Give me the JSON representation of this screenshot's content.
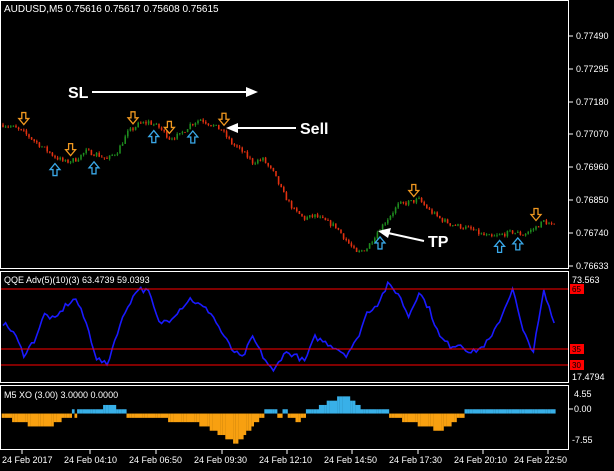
{
  "colors": {
    "background": "#000000",
    "frame": "#ffffff",
    "bull": "#1e8c1e",
    "bear": "#e03010",
    "buy_arrow": "#3aa8e8",
    "sell_arrow": "#f09820",
    "qqe_line": "#1a1aff",
    "level_line": "#ff0000",
    "xo_positive": "#38b0e8",
    "xo_negative": "#f8a010",
    "annotation": "#ffffff"
  },
  "main_chart": {
    "title": "AUDUSD,M5  0.75616 0.75617 0.75608 0.75615",
    "y_labels": [
      "0.77490",
      "0.77295",
      "0.77180",
      "0.77070",
      "0.76960",
      "0.76850",
      "0.76740",
      "0.76633"
    ],
    "annotations": [
      "SL",
      "Sell",
      "TP"
    ]
  },
  "qqe_panel": {
    "title": "QQE Adv(5)(10)(3) 63.4739 59.0393",
    "top_label": "73.563",
    "bottom_label": "17.4794",
    "levels": [
      "65",
      "35",
      "30"
    ]
  },
  "xo_panel": {
    "title": "M5 XO (3.00) 3.0000 0.0000",
    "y_labels": [
      "4.55",
      "0.00",
      "-7.55"
    ]
  },
  "time_axis": [
    "24 Feb 2017",
    "24 Feb 04:10",
    "24 Feb 06:50",
    "24 Feb 09:30",
    "24 Feb 12:10",
    "24 Feb 14:50",
    "24 Feb 17:30",
    "24 Feb 20:10",
    "24 Feb 22:50"
  ],
  "chart_data": {
    "type": "line",
    "close_key": [
      [
        0,
        0.7716
      ],
      [
        4,
        0.7715
      ],
      [
        8,
        0.7713
      ],
      [
        12,
        0.771
      ],
      [
        16,
        0.7707
      ],
      [
        20,
        0.7704
      ],
      [
        24,
        0.7702
      ],
      [
        28,
        0.7703
      ],
      [
        32,
        0.7706
      ],
      [
        36,
        0.7705
      ],
      [
        40,
        0.7703
      ],
      [
        44,
        0.7706
      ],
      [
        48,
        0.7713
      ],
      [
        52,
        0.7716
      ],
      [
        56,
        0.7717
      ],
      [
        60,
        0.7715
      ],
      [
        64,
        0.7711
      ],
      [
        68,
        0.7712
      ],
      [
        72,
        0.7716
      ],
      [
        76,
        0.7718
      ],
      [
        80,
        0.7716
      ],
      [
        84,
        0.7714
      ],
      [
        88,
        0.7709
      ],
      [
        92,
        0.7706
      ],
      [
        96,
        0.7702
      ],
      [
        100,
        0.7703
      ],
      [
        104,
        0.7698
      ],
      [
        108,
        0.769
      ],
      [
        112,
        0.7684
      ],
      [
        116,
        0.7681
      ],
      [
        120,
        0.7682
      ],
      [
        124,
        0.768
      ],
      [
        128,
        0.7678
      ],
      [
        132,
        0.7673
      ],
      [
        136,
        0.7668
      ],
      [
        140,
        0.767
      ],
      [
        144,
        0.7676
      ],
      [
        148,
        0.7681
      ],
      [
        152,
        0.7686
      ],
      [
        156,
        0.7687
      ],
      [
        160,
        0.7688
      ],
      [
        164,
        0.7684
      ],
      [
        168,
        0.7681
      ],
      [
        172,
        0.7679
      ],
      [
        176,
        0.7678
      ],
      [
        180,
        0.7677
      ],
      [
        184,
        0.7675
      ],
      [
        188,
        0.7674
      ],
      [
        192,
        0.7675
      ],
      [
        196,
        0.7676
      ],
      [
        200,
        0.7675
      ],
      [
        204,
        0.7677
      ],
      [
        208,
        0.768
      ],
      [
        212,
        0.7678
      ]
    ],
    "qqe_key": [
      [
        0,
        50
      ],
      [
        4,
        45
      ],
      [
        8,
        32
      ],
      [
        12,
        40
      ],
      [
        16,
        55
      ],
      [
        20,
        52
      ],
      [
        24,
        60
      ],
      [
        28,
        64
      ],
      [
        32,
        50
      ],
      [
        36,
        30
      ],
      [
        40,
        26
      ],
      [
        44,
        45
      ],
      [
        48,
        60
      ],
      [
        52,
        70
      ],
      [
        56,
        68
      ],
      [
        60,
        50
      ],
      [
        64,
        52
      ],
      [
        68,
        58
      ],
      [
        72,
        64
      ],
      [
        76,
        60
      ],
      [
        80,
        56
      ],
      [
        84,
        45
      ],
      [
        88,
        35
      ],
      [
        92,
        30
      ],
      [
        96,
        42
      ],
      [
        100,
        31
      ],
      [
        104,
        22
      ],
      [
        108,
        33
      ],
      [
        112,
        32
      ],
      [
        116,
        28
      ],
      [
        120,
        42
      ],
      [
        124,
        39
      ],
      [
        128,
        36
      ],
      [
        132,
        32
      ],
      [
        136,
        40
      ],
      [
        140,
        56
      ],
      [
        144,
        61
      ],
      [
        148,
        72
      ],
      [
        152,
        67
      ],
      [
        156,
        54
      ],
      [
        160,
        68
      ],
      [
        164,
        58
      ],
      [
        168,
        42
      ],
      [
        172,
        37
      ],
      [
        176,
        38
      ],
      [
        180,
        33
      ],
      [
        184,
        36
      ],
      [
        188,
        42
      ],
      [
        192,
        55
      ],
      [
        196,
        70
      ],
      [
        200,
        45
      ],
      [
        204,
        34
      ],
      [
        208,
        68
      ],
      [
        212,
        50
      ]
    ],
    "xo_key": [
      [
        0,
        -1
      ],
      [
        6,
        -2
      ],
      [
        12,
        -3
      ],
      [
        18,
        -3
      ],
      [
        24,
        -1
      ],
      [
        30,
        1
      ],
      [
        36,
        1
      ],
      [
        42,
        2
      ],
      [
        48,
        0
      ],
      [
        54,
        -1
      ],
      [
        60,
        -1
      ],
      [
        66,
        -2
      ],
      [
        72,
        -2
      ],
      [
        78,
        -3
      ],
      [
        84,
        -5
      ],
      [
        90,
        -7
      ],
      [
        96,
        -3
      ],
      [
        102,
        1
      ],
      [
        108,
        0
      ],
      [
        114,
        -2
      ],
      [
        120,
        1
      ],
      [
        126,
        3
      ],
      [
        132,
        4
      ],
      [
        138,
        1
      ],
      [
        144,
        1
      ],
      [
        150,
        -1
      ],
      [
        156,
        -2
      ],
      [
        162,
        -3
      ],
      [
        168,
        -4
      ],
      [
        174,
        -2
      ],
      [
        180,
        1
      ],
      [
        186,
        1
      ],
      [
        192,
        1
      ],
      [
        198,
        1
      ],
      [
        204,
        1
      ],
      [
        212,
        1
      ]
    ]
  }
}
